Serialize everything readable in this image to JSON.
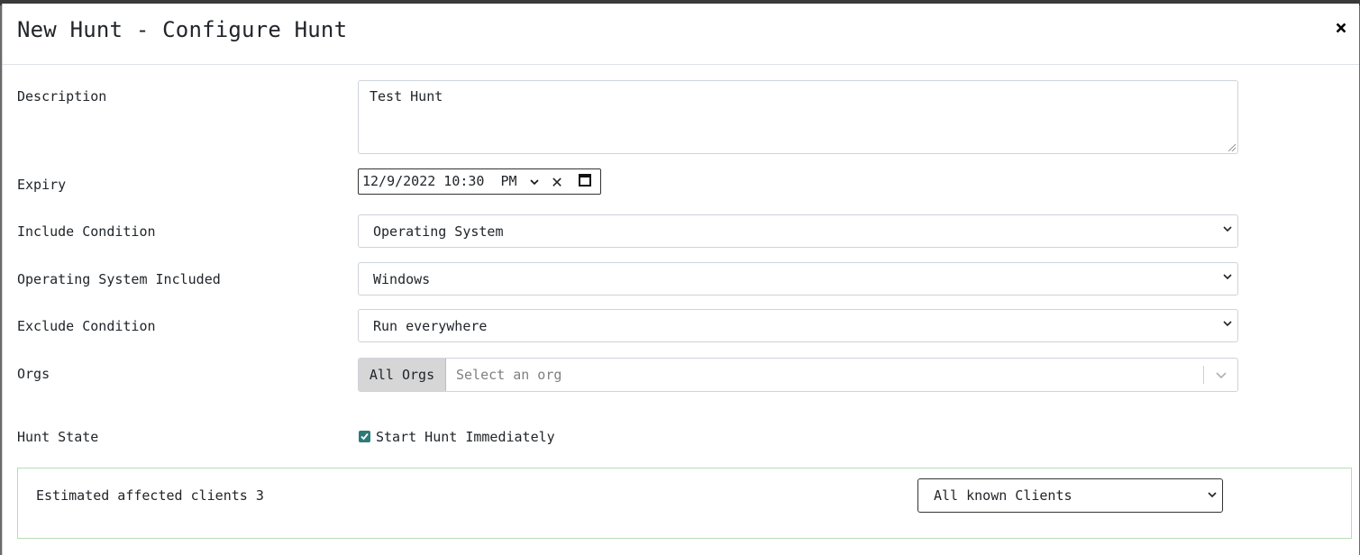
{
  "header": {
    "title": "New Hunt - Configure Hunt",
    "close_label": "×"
  },
  "form": {
    "description": {
      "label": "Description",
      "value": "Test Hunt"
    },
    "expiry": {
      "label": "Expiry",
      "value": "12/9/2022 10:30  PM"
    },
    "include_condition": {
      "label": "Include Condition",
      "value": "Operating System"
    },
    "os_included": {
      "label": "Operating System Included",
      "value": "Windows"
    },
    "exclude_condition": {
      "label": "Exclude Condition",
      "value": "Run everywhere"
    },
    "orgs": {
      "label": "Orgs",
      "button_label": "All Orgs",
      "placeholder": "Select an org"
    },
    "hunt_state": {
      "label": "Hunt State",
      "checkbox_label": "Start Hunt Immediately",
      "checked": true
    }
  },
  "estimate": {
    "text": "Estimated affected clients 3",
    "selected": "All known Clients"
  },
  "colors": {
    "checkbox": "#2d7b78",
    "estimate_border": "#b7dcb7"
  }
}
